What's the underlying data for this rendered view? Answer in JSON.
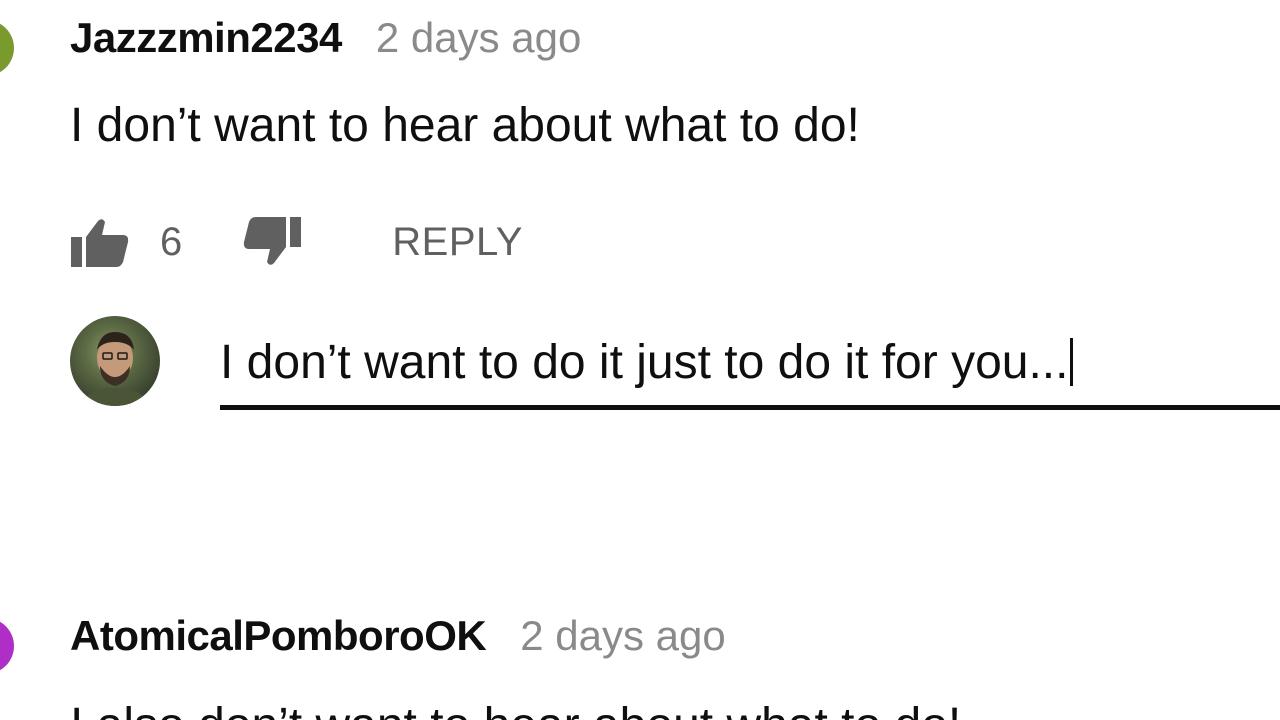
{
  "comments": [
    {
      "author": "Jazzzmin2234",
      "time": "2 days ago",
      "text": "I don’t want to hear about what to do!",
      "likes": "6",
      "reply_label": "REPLY",
      "avatar_color": "#7a9a2e"
    },
    {
      "author": "AtomicalPomboroOK",
      "time": "2 days ago",
      "text": "I also don’t want to hear about what to do!",
      "avatar_color": "#b02ec8"
    }
  ],
  "reply_input": {
    "value": "I don’t want to do it just to do it for you..."
  },
  "icons": {
    "like": "thumbs-up-icon",
    "dislike": "thumbs-down-icon"
  }
}
